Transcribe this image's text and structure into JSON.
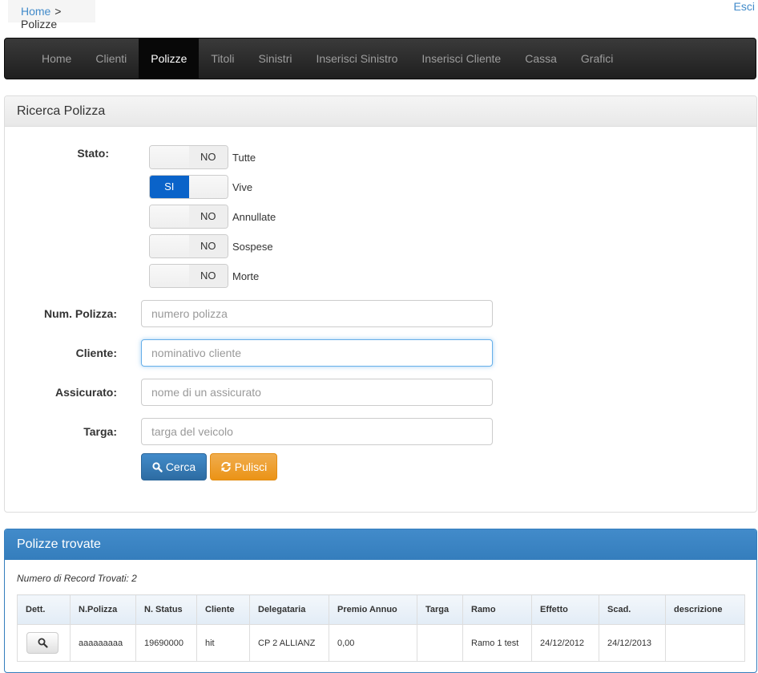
{
  "breadcrumb": {
    "home": "Home",
    "separator": ">",
    "current": "Polizze"
  },
  "logout": "Esci",
  "nav": [
    {
      "label": "Home",
      "active": false
    },
    {
      "label": "Clienti",
      "active": false
    },
    {
      "label": "Polizze",
      "active": true
    },
    {
      "label": "Titoli",
      "active": false
    },
    {
      "label": "Sinistri",
      "active": false
    },
    {
      "label": "Inserisci Sinistro",
      "active": false
    },
    {
      "label": "Inserisci Cliente",
      "active": false
    },
    {
      "label": "Cassa",
      "active": false
    },
    {
      "label": "Grafici",
      "active": false
    }
  ],
  "search": {
    "title": "Ricerca Polizza",
    "stato_label": "Stato:",
    "toggles": [
      {
        "text": "Tutte",
        "state": "NO"
      },
      {
        "text": "Vive",
        "state": "SI"
      },
      {
        "text": "Annullate",
        "state": "NO"
      },
      {
        "text": "Sospese",
        "state": "NO"
      },
      {
        "text": "Morte",
        "state": "NO"
      }
    ],
    "fields": [
      {
        "label": "Num. Polizza:",
        "placeholder": "numero polizza",
        "value": ""
      },
      {
        "label": "Cliente:",
        "placeholder": "nominativo cliente",
        "value": ""
      },
      {
        "label": "Assicurato:",
        "placeholder": "nome di un assicurato",
        "value": ""
      },
      {
        "label": "Targa:",
        "placeholder": "targa del veicolo",
        "value": ""
      }
    ],
    "search_button": "Cerca",
    "clear_button": "Pulisci"
  },
  "results": {
    "title": "Polizze trovate",
    "record_count_text": "Numero di Record Trovati: 2",
    "columns": [
      "Dett.",
      "N.Polizza",
      "N. Status",
      "Cliente",
      "Delegataria",
      "Premio Annuo",
      "Targa",
      "Ramo",
      "Effetto",
      "Scad.",
      "descrizione"
    ],
    "rows": [
      {
        "n_polizza": "aaaaaaaaa",
        "n_status": "19690000",
        "cliente": "hit",
        "delegataria": "CP 2 ALLIANZ",
        "premio": "0,00",
        "targa": "",
        "ramo": "Ramo 1 test",
        "effetto": "24/12/2012",
        "scadenza": "24/12/2013",
        "descrizione": ""
      }
    ]
  },
  "colors": {
    "nav_bg": "#222222",
    "nav_active": "#080808",
    "primary": "#428bca",
    "warning": "#f0ad4e",
    "toggle_on": "#0a63c9"
  },
  "icons": {
    "search": "search-icon",
    "refresh": "refresh-icon",
    "view": "magnifier-icon"
  }
}
